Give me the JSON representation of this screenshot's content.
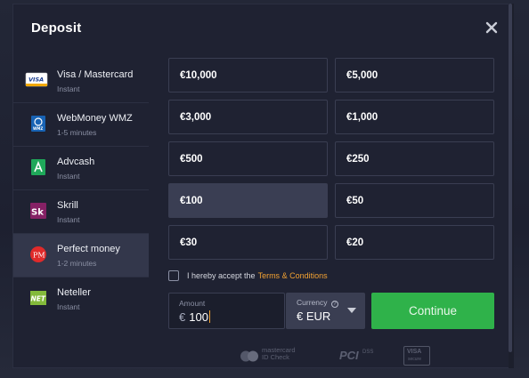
{
  "modal": {
    "title": "Deposit"
  },
  "methods": [
    {
      "name": "Visa / Mastercard",
      "sub": "Instant",
      "icon": "visa-mastercard-icon",
      "active": false
    },
    {
      "name": "WebMoney WMZ",
      "sub": "1-5 minutes",
      "icon": "webmoney-icon",
      "active": false
    },
    {
      "name": "Advcash",
      "sub": "Instant",
      "icon": "advcash-icon",
      "active": false
    },
    {
      "name": "Skrill",
      "sub": "Instant",
      "icon": "skrill-icon",
      "active": false
    },
    {
      "name": "Perfect money",
      "sub": "1-2 minutes",
      "icon": "perfect-money-icon",
      "active": true
    },
    {
      "name": "Neteller",
      "sub": "Instant",
      "icon": "neteller-icon",
      "active": false
    }
  ],
  "icon_labels": {
    "visa": "VISA",
    "webmoney": "WMZ",
    "skrill": "Sk",
    "perfect_money": "PM",
    "neteller": "NET"
  },
  "amounts": [
    {
      "label": "€10,000",
      "selected": false
    },
    {
      "label": "€5,000",
      "selected": false
    },
    {
      "label": "€3,000",
      "selected": false
    },
    {
      "label": "€1,000",
      "selected": false
    },
    {
      "label": "€500",
      "selected": false
    },
    {
      "label": "€250",
      "selected": false
    },
    {
      "label": "€100",
      "selected": true
    },
    {
      "label": "€50",
      "selected": false
    },
    {
      "label": "€30",
      "selected": false
    },
    {
      "label": "€20",
      "selected": false
    }
  ],
  "terms": {
    "text": "I hereby accept the",
    "link": "Terms & Conditions",
    "checked": false
  },
  "amount_field": {
    "label": "Amount",
    "currency_symbol": "€",
    "value": "100"
  },
  "currency_field": {
    "label": "Currency",
    "help": "?",
    "value": "€ EUR"
  },
  "continue": {
    "label": "Continue"
  },
  "badges": {
    "mastercard_line1": "mastercard",
    "mastercard_line2": "ID Check",
    "pci": "PCI",
    "pci_dss": "DSS",
    "visa": "VISA",
    "visa_sub": "secure"
  },
  "colors": {
    "accent_green": "#2fb24a",
    "terms_link": "#f3a232",
    "active_row": "#33374b",
    "modal_bg": "#1f2232"
  }
}
